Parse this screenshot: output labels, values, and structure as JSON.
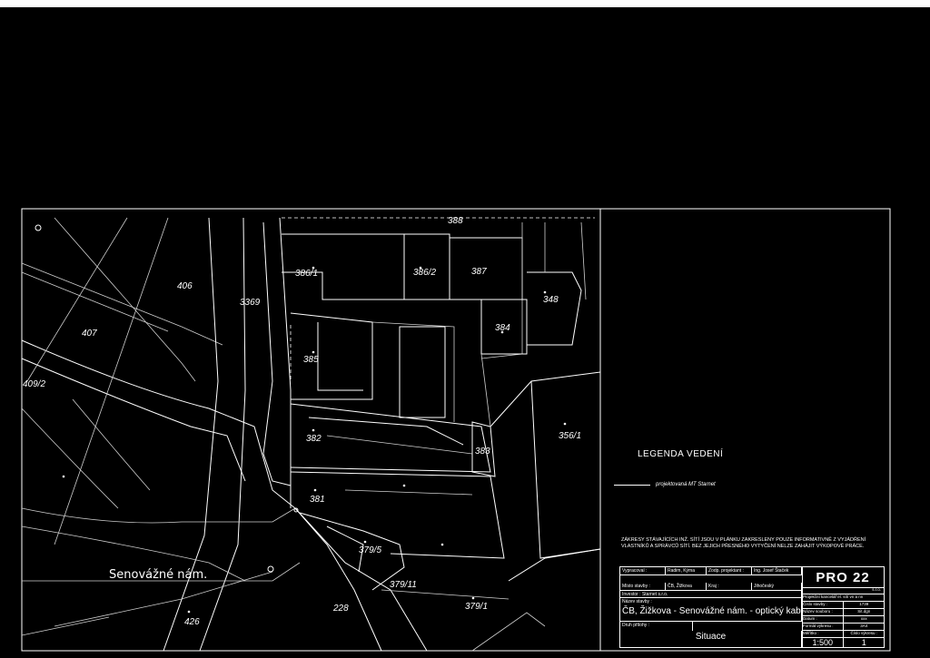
{
  "parcels": [
    "388",
    "386/1",
    "386/2",
    "387",
    "406",
    "3369",
    "348",
    "384",
    "407",
    "385",
    "409/2",
    "356/1",
    "382",
    "383",
    "381",
    "379/5",
    "379/11",
    "228",
    "379/1",
    "426"
  ],
  "street_label": "Senovážné nám.",
  "legend": {
    "title": "LEGENDA VEDENÍ",
    "item": "projektovaná MT Starnet"
  },
  "note": "ZÁKRESY STÁVAJÍCÍCH INŽ. SÍTÍ JSOU V PLÁNKU ZAKRESLENY POUZE INFORMATIVNĚ Z VYJÁDŘENÍ VLASTNÍKŮ A SPRÁVCŮ SÍTÍ. BEZ JEJICH PŘESNÉHO VYTYČENÍ NELZE ZAHÁJIT VÝKOPOVÉ PRÁCE.",
  "title_block": {
    "vypracoval_label": "Vypracoval :",
    "vypracoval_value": "Radim, Kýma",
    "zodp_label": "Zodp. projektant :",
    "zodp_value": "Ing. Josef Štaček",
    "misto_label": "Místo stavby :",
    "misto_value": "ČB, Žižkova",
    "kraj_label": "Kraj :",
    "kraj_value": "Jihočeský",
    "investor": "Investor : Starnet s.r.o.",
    "nazev_label": "Název stavby :",
    "nazev_value": "ČB, Žižkova - Senovážné nám. - optický kabel Starnet",
    "druh_label": "Druh přílohy :",
    "druh_value": "Situace",
    "logo": "PRO 22",
    "logo_sub": "s.r.o.",
    "kancelar": "Projekční kancelář el. sítí vn a nn",
    "cislo_stavby_label": "Číslo stavby :",
    "cislo_stavby_value": "1739",
    "nazev_souboru_label": "Název souboru :",
    "nazev_souboru_value": "Sit.dgn",
    "datum_label": "Datum :",
    "datum_value": "xxx",
    "format_label": "Formát výkresu :",
    "format_value": "3A4",
    "meritko_label": "Měřítko :",
    "meritko_value": "1:500",
    "cislo_vykresu_label": "Číslo výkresu :",
    "cislo_vykresu_value": "1"
  }
}
